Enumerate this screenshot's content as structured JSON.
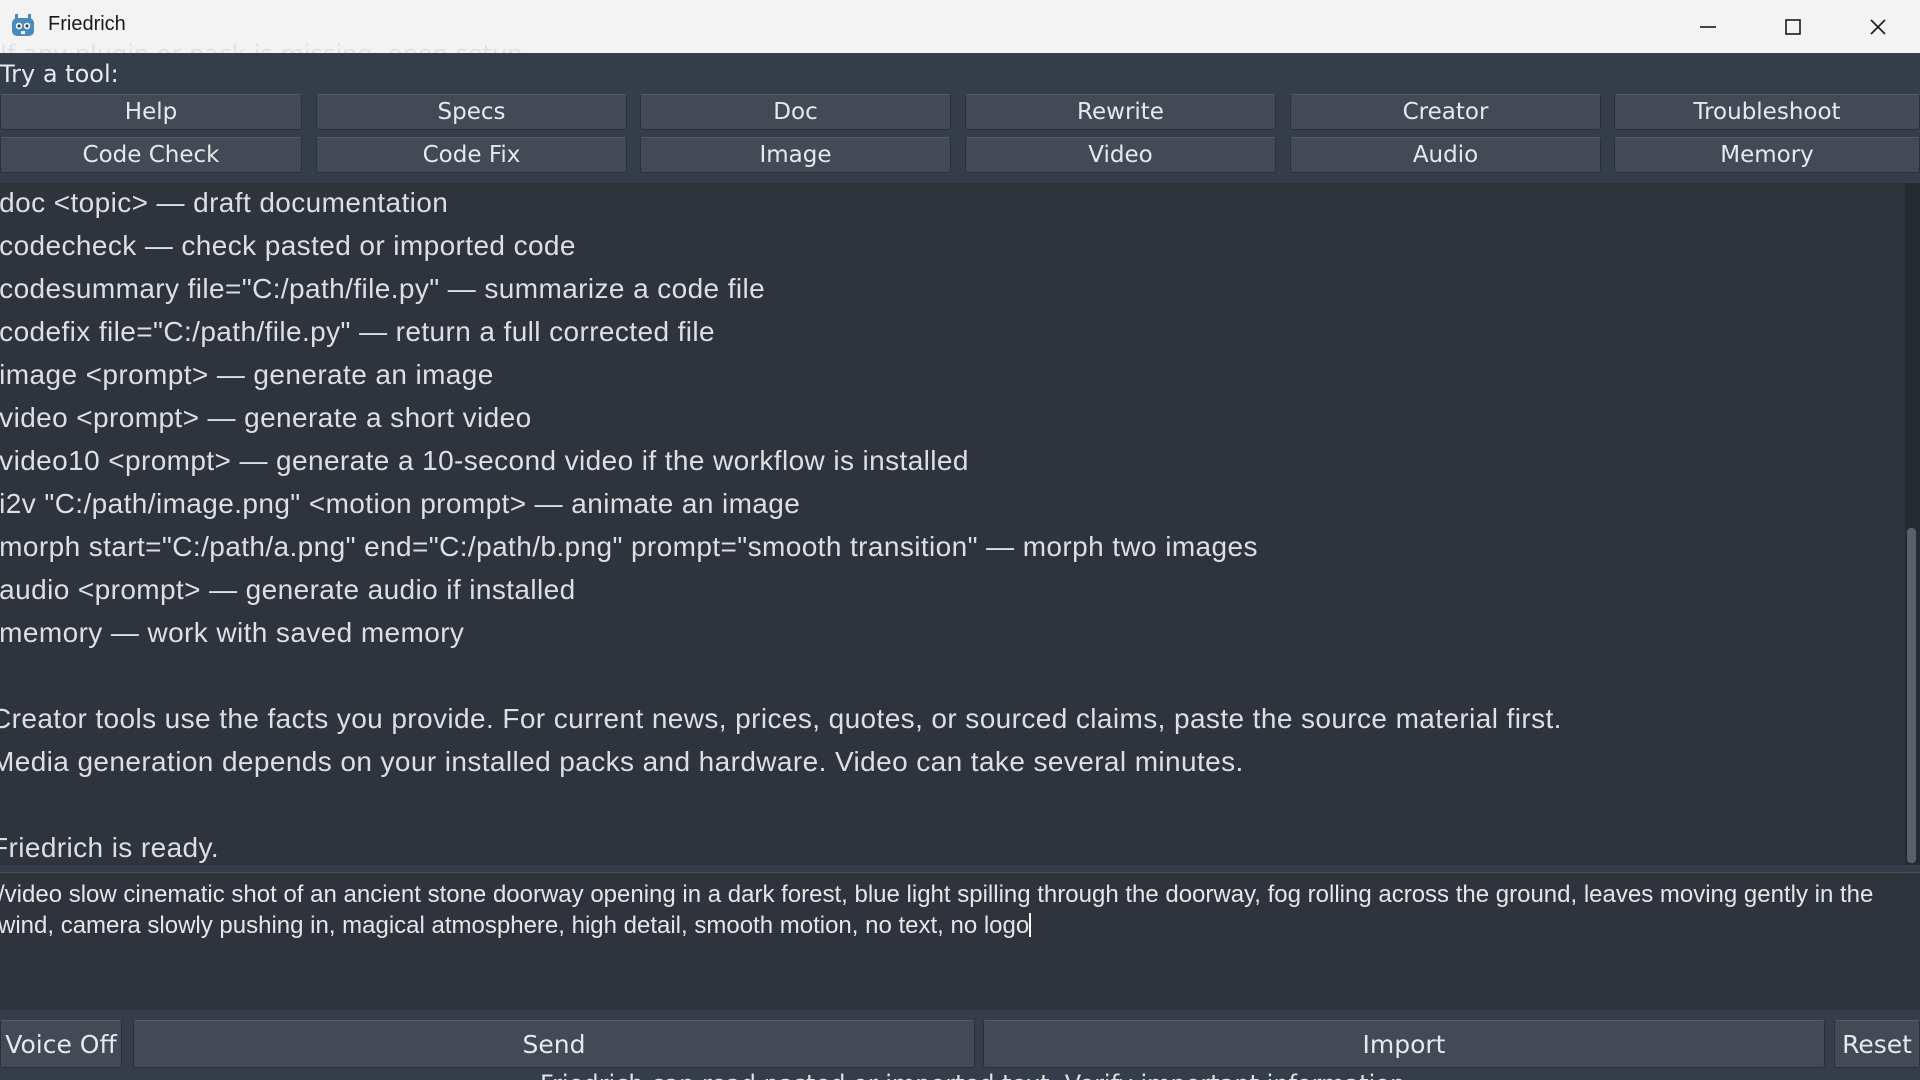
{
  "window": {
    "title": "Friedrich",
    "icon": "godot-robot-icon"
  },
  "top_clipped_line": "If any plugin or pack is missing, open setup",
  "try_label": "Try a tool:",
  "tools_row1": [
    "Help",
    "Specs",
    "Doc",
    "Rewrite",
    "Creator",
    "Troubleshoot"
  ],
  "tools_row2": [
    "Code Check",
    "Code Fix",
    "Image",
    "Video",
    "Audio",
    "Memory"
  ],
  "output_lines": [
    "/doc <topic> — draft documentation",
    "/codecheck — check pasted or imported code",
    "/codesummary file=\"C:/path/file.py\" — summarize a code file",
    "/codefix file=\"C:/path/file.py\" — return a full corrected file",
    "/image <prompt> — generate an image",
    "/video <prompt> — generate a short video",
    "/video10 <prompt> — generate a 10-second video if the workflow is installed",
    "/i2v \"C:/path/image.png\" <motion prompt> — animate an image",
    "/morph start=\"C:/path/a.png\" end=\"C:/path/b.png\" prompt=\"smooth transition\" — morph two images",
    "/audio <prompt> — generate audio if installed",
    "/memory — work with saved memory",
    "",
    "Creator tools use the facts you provide. For current news, prices, quotes, or sourced claims, paste the source material first.",
    "Media generation depends on your installed packs and hardware. Video can take several minutes.",
    "",
    "Friedrich is ready."
  ],
  "input": {
    "value": "/video slow cinematic shot of an ancient stone doorway opening in a dark forest, blue light spilling through the doorway, fog rolling across the ground, leaves moving gently in the wind, camera slowly pushing in, magical atmosphere, high detail, smooth motion, no text, no logo"
  },
  "bottom": {
    "voice_label": "Voice Off",
    "send_label": "Send",
    "import_label": "Import",
    "reset_label": "Reset",
    "status_clipped": "Friedrich can read pasted or imported text. Verify important information."
  },
  "colors": {
    "background": "#363d4a",
    "panel": "#2f333b",
    "button": "#434a56",
    "text": "#e6e8ec"
  }
}
